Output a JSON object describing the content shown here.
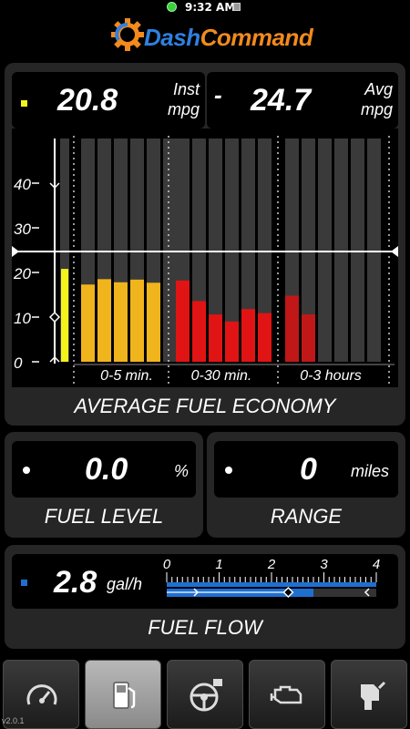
{
  "status_bar": {
    "time": "9:32 AM"
  },
  "app": {
    "name_part1": "Dash",
    "name_part2": "Command"
  },
  "economy": {
    "inst_value": "20.8",
    "inst_unit_line1": "Inst",
    "inst_unit_line2": "mpg",
    "separator": "-",
    "avg_value": "24.7",
    "avg_unit_line1": "Avg",
    "avg_unit_line2": "mpg",
    "caption": "AVERAGE FUEL ECONOMY",
    "colors": {
      "inst_square": "#f3f21a",
      "bar_5min": "#f0b41c",
      "bar_30min": "#e01414",
      "bar_3hr": "#c01818"
    }
  },
  "chart_data": {
    "type": "bar",
    "ylim": [
      0,
      50
    ],
    "yticks": [
      "0",
      "10",
      "20",
      "30",
      "40"
    ],
    "average_line": 24.7,
    "current_value": 20.8,
    "groups": [
      {
        "label": "0-5 min.",
        "slots": 6,
        "values": [
          17.3,
          18.5,
          17.8,
          18.4,
          17.7
        ]
      },
      {
        "label": "0-30 min.",
        "slots": 6,
        "values": [
          18.2,
          13.6,
          10.6,
          9.0,
          11.8,
          10.9
        ]
      },
      {
        "label": "0-3 hours",
        "slots": 6,
        "values": [
          14.8,
          10.6
        ]
      }
    ]
  },
  "fuel_level": {
    "value": "0.0",
    "unit": "%",
    "caption": "FUEL LEVEL"
  },
  "range": {
    "value": "0",
    "unit": "miles",
    "caption": "RANGE"
  },
  "fuel_flow": {
    "value": "2.8",
    "unit": "gal/h",
    "caption": "FUEL FLOW",
    "scale": [
      "0",
      "1",
      "2",
      "3",
      "4"
    ],
    "scale_max": 4,
    "current_fraction": 0.7,
    "avg_fraction": 0.58,
    "color": "#1f6fd0"
  },
  "tabs": [
    {
      "name": "gauges",
      "icon": "speedometer-icon"
    },
    {
      "name": "fuel",
      "icon": "fuel-pump-icon"
    },
    {
      "name": "driving",
      "icon": "steering-wheel-icon"
    },
    {
      "name": "engine",
      "icon": "engine-icon"
    },
    {
      "name": "refuel",
      "icon": "fuel-nozzle-icon"
    }
  ],
  "version": "v2.0.1"
}
